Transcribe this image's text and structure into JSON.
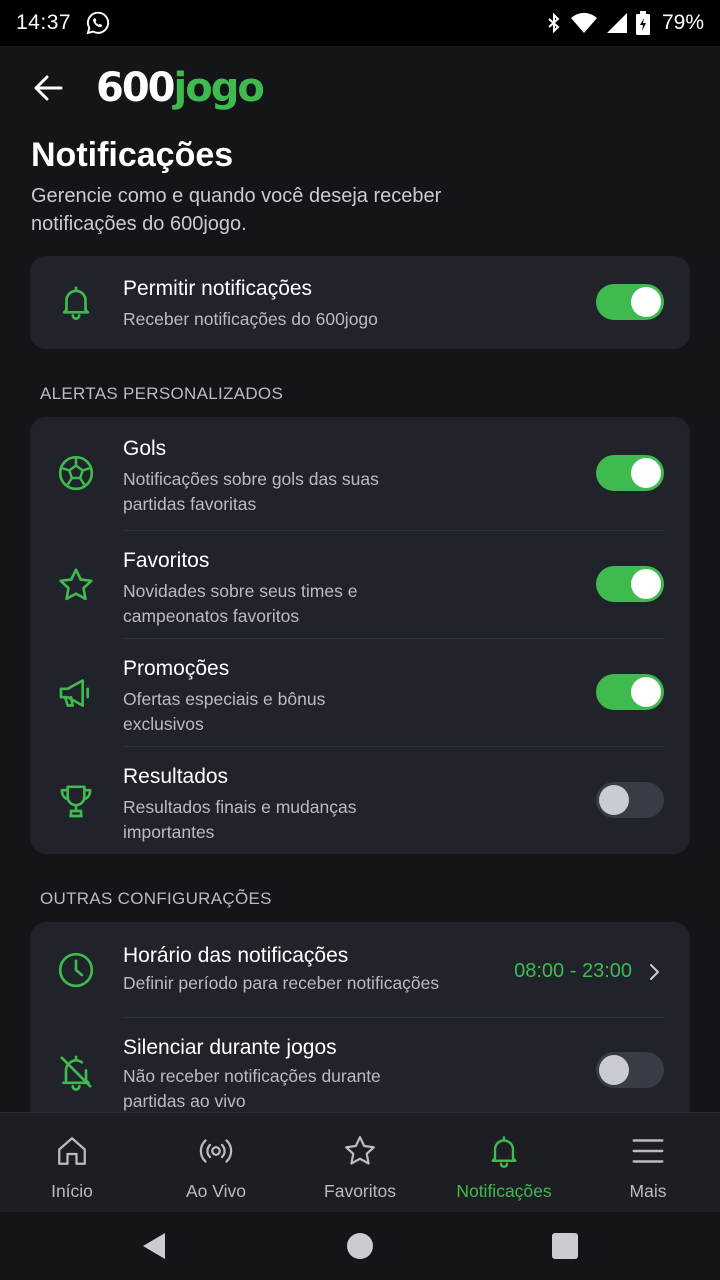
{
  "status_bar": {
    "time": "14:37",
    "battery": "79%"
  },
  "app": {
    "logo_number": "600",
    "logo_word": "jogo"
  },
  "header": {
    "title": "Notificações",
    "description": "Gerencie como e quando você deseja receber notificações do 600jogo."
  },
  "master": {
    "title": "Permitir notificações",
    "subtitle": "Receber notificações do 600jogo",
    "enabled": true,
    "icon": "bell-icon"
  },
  "alerts_section": {
    "label": "ALERTAS PERSONALIZADOS",
    "items": [
      {
        "title": "Gols",
        "subtitle": "Notificações sobre gols das suas partidas favoritas",
        "enabled": true,
        "icon": "soccer-ball-icon"
      },
      {
        "title": "Favoritos",
        "subtitle": "Novidades sobre seus times e campeonatos favoritos",
        "enabled": true,
        "icon": "star-icon"
      },
      {
        "title": "Promoções",
        "subtitle": "Ofertas especiais e bônus exclusivos",
        "enabled": true,
        "icon": "megaphone-icon"
      },
      {
        "title": "Resultados",
        "subtitle": "Resultados finais e mudanças importantes",
        "enabled": false,
        "icon": "trophy-icon"
      }
    ]
  },
  "other_section": {
    "label": "OUTRAS CONFIGURAÇÕES",
    "schedule": {
      "title": "Horário das notificações",
      "subtitle": "Definir período para receber notificações",
      "value": "08:00 - 23:00",
      "icon": "clock-icon"
    },
    "mute": {
      "title": "Silenciar durante jogos",
      "subtitle": "Não receber notificações durante partidas ao vivo",
      "enabled": false,
      "icon": "bell-off-icon"
    }
  },
  "bottom_nav": {
    "items": [
      {
        "label": "Início",
        "icon": "home-icon",
        "active": false
      },
      {
        "label": "Ao Vivo",
        "icon": "live-icon",
        "active": false
      },
      {
        "label": "Favoritos",
        "icon": "star-icon",
        "active": false
      },
      {
        "label": "Notificações",
        "icon": "bell-icon",
        "active": true
      },
      {
        "label": "Mais",
        "icon": "menu-icon",
        "active": false
      }
    ]
  },
  "colors": {
    "accent": "#3fba4f",
    "background": "#131519",
    "card": "#20232a"
  }
}
